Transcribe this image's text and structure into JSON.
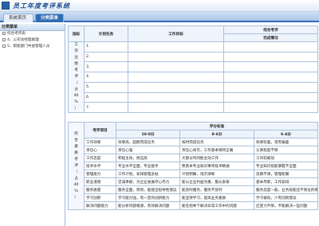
{
  "app": {
    "title": "员工年度考评系统"
  },
  "tabs": [
    {
      "label": "系统首页"
    },
    {
      "label": "分类菜单"
    }
  ],
  "sidebar": {
    "header": "分类菜单",
    "items": [
      {
        "label": "综合考评表"
      },
      {
        "label": "4、公司总经理助理"
      },
      {
        "label": "5、职能部门中层管理人员"
      }
    ]
  },
  "plan_table": {
    "col_seq": "指标",
    "col_plan": "计划任务",
    "col_target": "工作目标",
    "group_header": "综合考评",
    "col_status": "完成情况",
    "section_label": "工作业绩考评（占40%）",
    "rows": [
      "1.",
      "2.",
      "3.",
      "4.",
      "5.",
      "6.",
      "7."
    ]
  },
  "quality_table": {
    "section_label": "综合素质考评（占40%）",
    "col_item": "考评项目",
    "group_header": "评分标准",
    "levels": [
      "10-8分",
      "8-6分",
      "6-4分"
    ],
    "rows": [
      {
        "item": "工作效果",
        "a": "效果高，超额完成任务",
        "b": "按时完成任务",
        "c": "效果较差，常有偏差"
      },
      {
        "item": "责任心",
        "a": "责任心强",
        "b": "责任心尚可，工作基本保持正确",
        "c": "认真程度不够"
      },
      {
        "item": "工作态度",
        "a": "积极主动，抗压高",
        "b": "大部分时间能主动工作",
        "c": "工作较被动"
      },
      {
        "item": "技术水平",
        "a": "专业水平全面，专业能手",
        "b": "熟悉本专业知识事项技术精通",
        "c": "专业知识技能掌握不全面"
      },
      {
        "item": "管理能力",
        "a": "工作计划，安排管理妥帖",
        "b": "计划明确，指示清晰",
        "c": "思路不清，管理松懈"
      },
      {
        "item": "职业道德",
        "a": "忠诚奉献，为企业发展尽心尽力",
        "b": "能以企业利益为重，服从安排",
        "c": "基本尽职，工作安排"
      },
      {
        "item": "服务质量",
        "a": "服务全面，周到，能提出指导性建议",
        "b": "能及时服务，服务不及时",
        "c": "服务态度一般，业务技能还不到位的情况"
      },
      {
        "item": "学习创新",
        "a": "学习能力强，有一定的创新能力",
        "b": "能坚持学习，提高业务素质",
        "c": "学习被动，少有创新建议"
      },
      {
        "item": "解决问题能力",
        "a": "能分析问题根源，有效解决问题",
        "b": "能在指导下解决日常工作中的问题",
        "c": "应变力不够，不能解决一些问题"
      }
    ]
  }
}
